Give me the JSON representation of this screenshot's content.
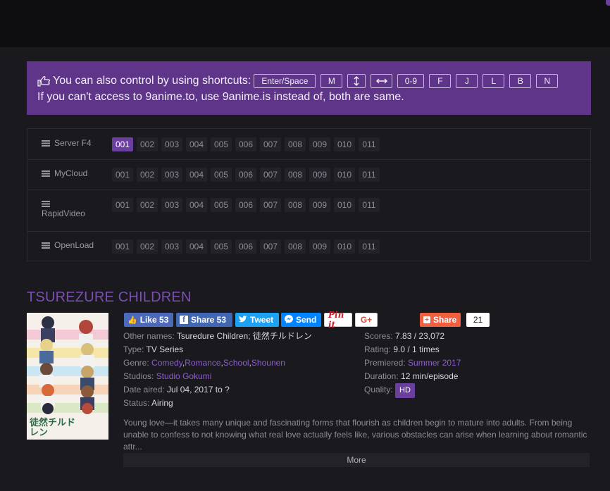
{
  "notice": {
    "line1": "You can also control by using shortcuts:",
    "keys": [
      "Enter/Space",
      "M",
      "",
      "",
      "0-9",
      "F",
      "J",
      "L",
      "B",
      "N"
    ],
    "line2": "If you can't access to 9anime.to, use 9anime.is instead of, both are same."
  },
  "servers": [
    {
      "name": "Server F4",
      "episodes": [
        "001",
        "002",
        "003",
        "004",
        "005",
        "006",
        "007",
        "008",
        "009",
        "010",
        "011"
      ],
      "active": "001"
    },
    {
      "name": "MyCloud",
      "episodes": [
        "001",
        "002",
        "003",
        "004",
        "005",
        "006",
        "007",
        "008",
        "009",
        "010",
        "011"
      ]
    },
    {
      "name": "RapidVideo",
      "episodes": [
        "001",
        "002",
        "003",
        "004",
        "005",
        "006",
        "007",
        "008",
        "009",
        "010",
        "011"
      ]
    },
    {
      "name": "OpenLoad",
      "episodes": [
        "001",
        "002",
        "003",
        "004",
        "005",
        "006",
        "007",
        "008",
        "009",
        "010",
        "011"
      ]
    }
  ],
  "anime": {
    "title": "TSUREZURE CHILDREN",
    "poster_text": "徒然チルドレン"
  },
  "social": {
    "like": "Like 53",
    "share_fb": "Share 53",
    "tweet": "Tweet",
    "send": "Send",
    "pinit": "Pin it",
    "gplus": "G+",
    "share": "Share",
    "share_count": "21"
  },
  "info_left": {
    "other_names_label": "Other names:",
    "other_names": "Tsuredure Children; 徒然チルドレン",
    "type_label": "Type:",
    "type": "TV Series",
    "genre_label": "Genre:",
    "genres": [
      "Comedy",
      "Romance",
      "School",
      "Shounen"
    ],
    "studios_label": "Studios:",
    "studios": "Studio Gokumi",
    "date_label": "Date aired:",
    "date": "Jul 04, 2017 to ?",
    "status_label": "Status:",
    "status": "Airing"
  },
  "info_right": {
    "scores_label": "Scores:",
    "scores": "7.83 / 23,072",
    "rating_label": "Rating:",
    "rating": "9.0 / 1 times",
    "premiered_label": "Premiered:",
    "premiered": "Summer 2017",
    "duration_label": "Duration:",
    "duration": "12 min/episode",
    "quality_label": "Quality:",
    "quality": "HD"
  },
  "description": "Young love—it takes many unique and fascinating forms that flourish as children begin to mature into adults. From being unable to confess to not knowing what real love actually feels like, various obstacles can arise when learning about romantic attr...",
  "more_label": "More",
  "colors": {
    "accent": "#6b3fa0",
    "notice_bg": "#5e3589",
    "page_bg": "#1a191e"
  }
}
